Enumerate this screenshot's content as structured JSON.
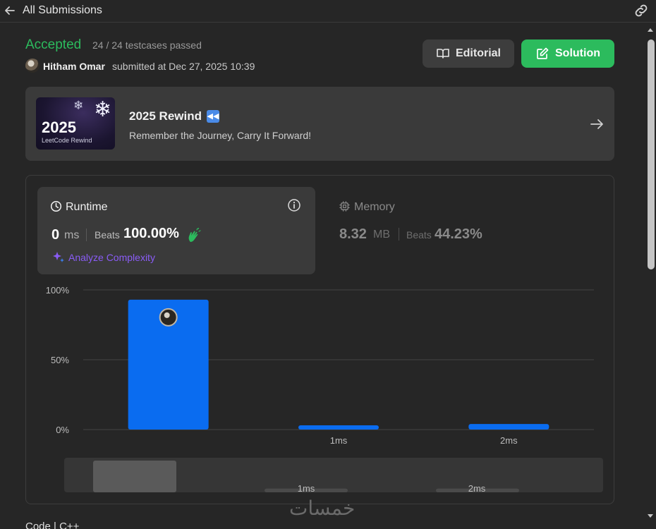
{
  "topbar": {
    "title": "All Submissions"
  },
  "header": {
    "status": "Accepted",
    "testcases": "24 / 24 testcases passed",
    "submitter": "Hitham Omar",
    "submitted_at": "submitted at Dec 27, 2025 10:39",
    "editorial_label": "Editorial",
    "solution_label": "Solution"
  },
  "banner": {
    "thumb_year": "2025",
    "thumb_sub": "LeetCode Rewind",
    "title": "2025 Rewind",
    "subtitle": "Remember the Journey, Carry It Forward!"
  },
  "runtime": {
    "label": "Runtime",
    "value": "0",
    "unit": "ms",
    "beats_label": "Beats",
    "beats": "100.00%",
    "analyze_label": "Analyze Complexity"
  },
  "memory": {
    "label": "Memory",
    "value": "8.32",
    "unit": "MB",
    "beats_label": "Beats",
    "beats": "44.23%"
  },
  "colors": {
    "accepted": "#2cbb5d",
    "bar": "#0a6cf0",
    "analyze": "#8a5cf6",
    "card": "#3a3a3a"
  },
  "chart_data": {
    "type": "bar",
    "categories": [
      "0ms",
      "1ms",
      "2ms"
    ],
    "tick_labels": [
      "",
      "1ms",
      "2ms"
    ],
    "values": [
      93,
      3,
      4
    ],
    "ylim": [
      0,
      100
    ],
    "y_ticks": [
      "0%",
      "50%",
      "100%"
    ],
    "y_tick_values": [
      0,
      50,
      100
    ],
    "grid": true,
    "highlight_index": 0,
    "brush": {
      "tick_labels": [
        "",
        "1ms",
        "2ms"
      ],
      "values": [
        100,
        12,
        12
      ]
    }
  },
  "footer": {
    "watermark": "خمسات",
    "code_label": "Code | C++"
  }
}
